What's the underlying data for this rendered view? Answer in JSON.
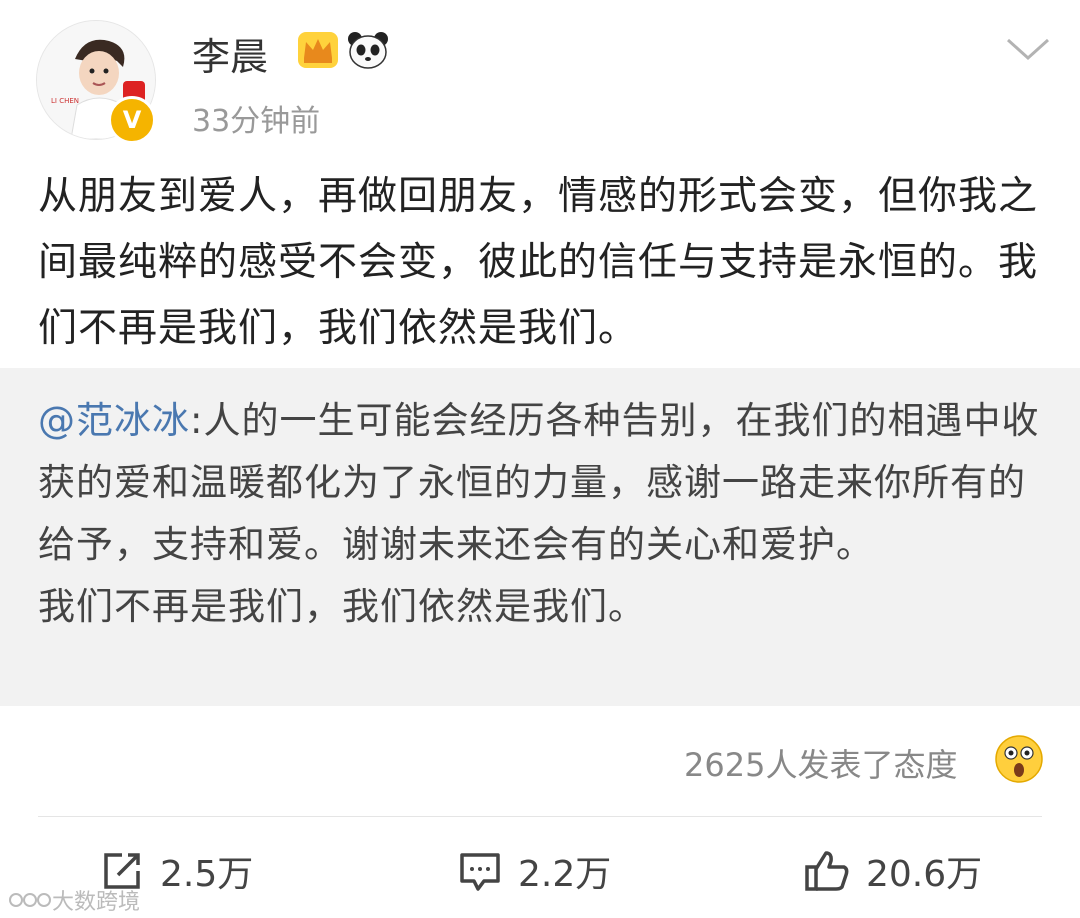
{
  "header": {
    "username": "李晨",
    "timestamp": "33分钟前",
    "avatar_label": "LI CHEN",
    "verified_badge": "V"
  },
  "post": {
    "text": "从朋友到爱人，再做回朋友，情感的形式会变，但你我之间最纯粹的感受不会变，彼此的信任与支持是永恒的。我们不再是我们，我们依然是我们。"
  },
  "retweet": {
    "mention": "@范冰冰",
    "text": ":人的一生可能会经历各种告别，在我们的相遇中收获的爱和温暖都化为了永恒的力量，感谢一路走来你所有的给予，支持和爱。谢谢未来还会有的关心和爱护。",
    "text2": "我们不再是我们，我们依然是我们。"
  },
  "reactions": {
    "summary": "2625人发表了态度",
    "emoji": "surprised-face-icon"
  },
  "actions": {
    "repost": "2.5万",
    "comment": "2.2万",
    "like": "20.6万"
  },
  "watermark": "大数跨境",
  "colors": {
    "mention": "#4a78b0",
    "retweet_bg": "#f2f2f2",
    "timestamp": "#999999",
    "badge": "#f5b400"
  }
}
